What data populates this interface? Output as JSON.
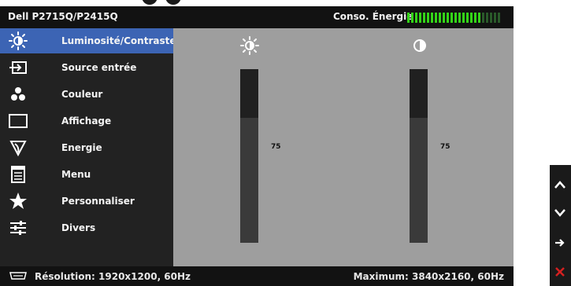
{
  "header": {
    "model": "Dell P2715Q/P2415Q",
    "energy_label": "Conso. Énergie",
    "energy_level": 0.8,
    "colors": {
      "energy_on": "#34d418",
      "energy_off": "#2a5a2a"
    }
  },
  "sidebar": {
    "active_color": "#3c64b4",
    "items": [
      {
        "label": "Luminosité/Contraste",
        "icon": "brightness-icon",
        "active": true
      },
      {
        "label": "Source entrée",
        "icon": "input-source-icon",
        "active": false
      },
      {
        "label": "Couleur",
        "icon": "color-dots-icon",
        "active": false
      },
      {
        "label": "Affichage",
        "icon": "display-rectangle-icon",
        "active": false
      },
      {
        "label": "Energie",
        "icon": "energy-leaf-icon",
        "active": false
      },
      {
        "label": "Menu",
        "icon": "menu-document-icon",
        "active": false
      },
      {
        "label": "Personnaliser",
        "icon": "star-icon",
        "active": false
      },
      {
        "label": "Divers",
        "icon": "sliders-icon",
        "active": false
      }
    ]
  },
  "content": {
    "brightness": {
      "icon": "brightness-icon",
      "value": "75",
      "level": 0.75
    },
    "contrast": {
      "icon": "contrast-icon",
      "value": "75",
      "level": 0.75
    }
  },
  "footer": {
    "icon": "connector-icon",
    "resolution": "Résolution: 1920x1200, 60Hz",
    "maximum": "Maximum: 3840x2160, 60Hz"
  },
  "side_buttons": [
    {
      "icon": "chevron-up-icon"
    },
    {
      "icon": "chevron-down-icon"
    },
    {
      "icon": "arrow-right-icon"
    },
    {
      "icon": "close-icon",
      "color": "#d62020"
    }
  ]
}
